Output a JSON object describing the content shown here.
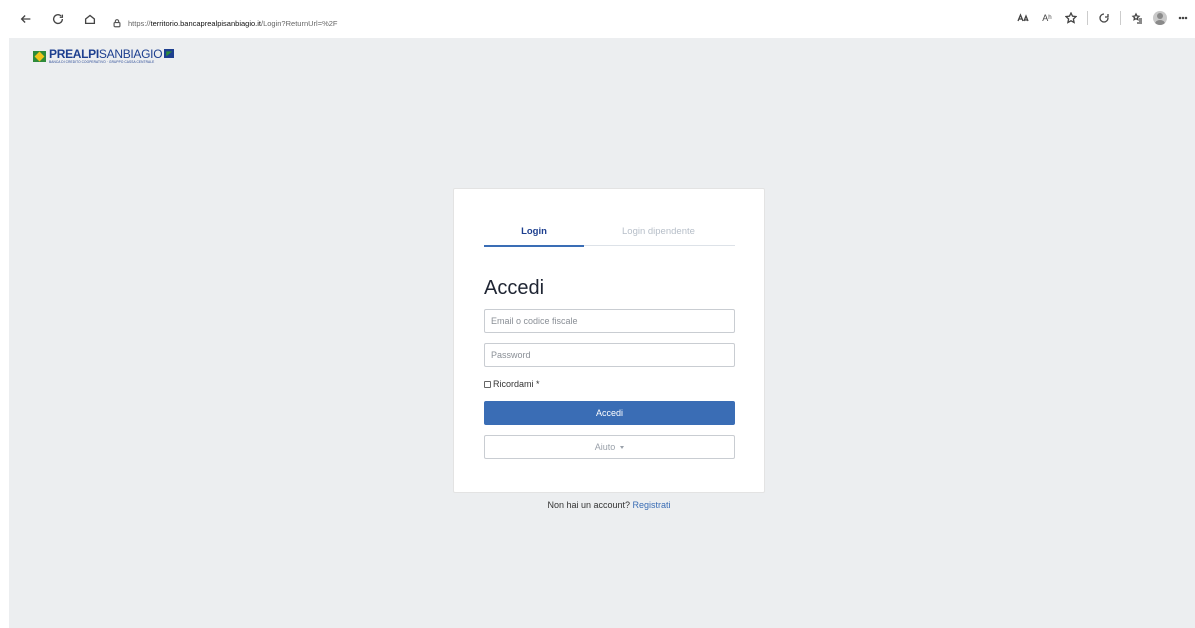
{
  "browser": {
    "url_proto": "https://",
    "url_host": "territorio.bancaprealpisanbiagio.it",
    "url_rest": "/Login?ReturnUrl=%2F",
    "read_aloud": "Aʰ"
  },
  "logo": {
    "main_bold": "PREALPI",
    "main_light": "SANBIAGIO",
    "sub": "BANCA DI CREDITO COOPERATIVO · GRUPPO CASSA CENTRALE"
  },
  "login": {
    "tabs": [
      {
        "label": "Login"
      },
      {
        "label": "Login dipendente"
      }
    ],
    "heading": "Accedi",
    "email_placeholder": "Email o codice fiscale",
    "password_placeholder": "Password",
    "remember_label": "Ricordami *",
    "submit_label": "Accedi",
    "help_label": "Aiuto"
  },
  "footer": {
    "prompt": "Non hai un account?",
    "register_link": "Registrati"
  },
  "colors": {
    "primary": "#3a6db5",
    "brand_blue": "#1d3f8f",
    "page_bg": "#eceef0"
  }
}
